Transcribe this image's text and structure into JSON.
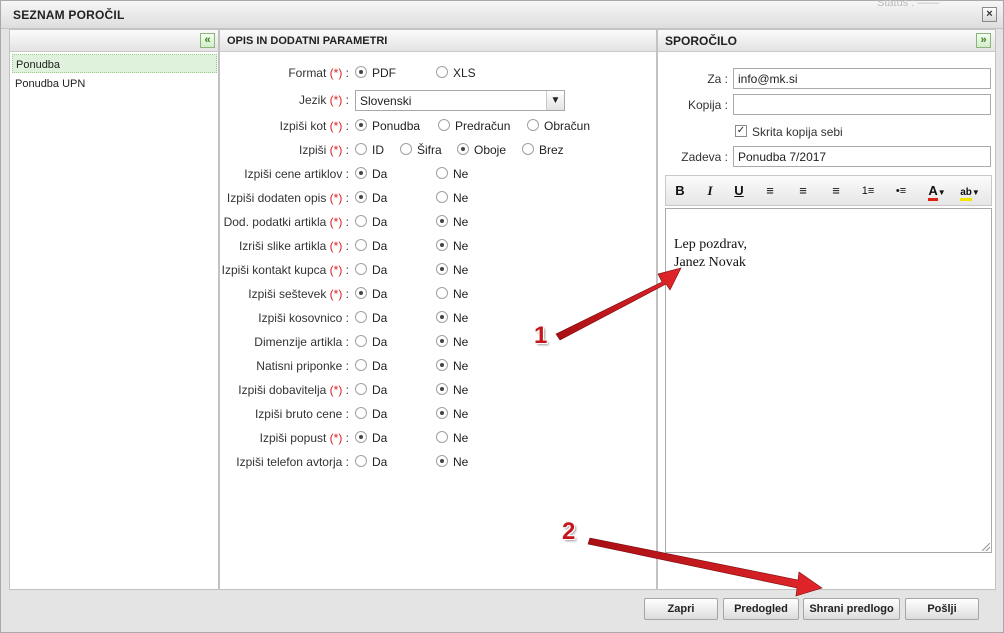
{
  "window": {
    "title": "SEZNAM POROČIL",
    "status": "Status : ——",
    "close_icon": "×"
  },
  "left_panel": {
    "collapse_icon": "«",
    "items": [
      {
        "label": "Ponudba",
        "selected": true
      },
      {
        "label": "Ponudba UPN",
        "selected": false
      }
    ]
  },
  "middle_panel": {
    "title": "OPIS IN DODATNI PARAMETRI",
    "rows": [
      {
        "label": "Format",
        "required": true,
        "type": "radio",
        "options": [
          {
            "label": "PDF",
            "checked": true
          },
          {
            "label": "XLS",
            "checked": false
          }
        ]
      },
      {
        "label": "Jezik",
        "required": true,
        "type": "select",
        "value": "Slovenski"
      },
      {
        "label": "Izpiši kot",
        "required": true,
        "type": "radio",
        "options": [
          {
            "label": "Ponudba",
            "checked": true
          },
          {
            "label": "Predračun",
            "checked": false
          },
          {
            "label": "Obračun",
            "checked": false
          }
        ]
      },
      {
        "label": "Izpiši",
        "required": true,
        "type": "radio",
        "options": [
          {
            "label": "ID",
            "checked": false
          },
          {
            "label": "Šifra",
            "checked": false
          },
          {
            "label": "Oboje",
            "checked": true
          },
          {
            "label": "Brez",
            "checked": false
          }
        ]
      },
      {
        "label": "Izpiši cene artiklov",
        "required": false,
        "type": "radio",
        "options": [
          {
            "label": "Da",
            "checked": true
          },
          {
            "label": "Ne",
            "checked": false
          }
        ]
      },
      {
        "label": "Izpiši dodaten opis",
        "required": true,
        "type": "radio",
        "options": [
          {
            "label": "Da",
            "checked": true
          },
          {
            "label": "Ne",
            "checked": false
          }
        ]
      },
      {
        "label": "Dod. podatki artikla",
        "required": true,
        "type": "radio",
        "options": [
          {
            "label": "Da",
            "checked": false
          },
          {
            "label": "Ne",
            "checked": true
          }
        ]
      },
      {
        "label": "Izriši slike artikla",
        "required": true,
        "type": "radio",
        "options": [
          {
            "label": "Da",
            "checked": false
          },
          {
            "label": "Ne",
            "checked": true
          }
        ]
      },
      {
        "label": "Izpiši kontakt kupca",
        "required": true,
        "type": "radio",
        "options": [
          {
            "label": "Da",
            "checked": false
          },
          {
            "label": "Ne",
            "checked": true
          }
        ]
      },
      {
        "label": "Izpiši seštevek",
        "required": true,
        "type": "radio",
        "options": [
          {
            "label": "Da",
            "checked": true
          },
          {
            "label": "Ne",
            "checked": false
          }
        ]
      },
      {
        "label": "Izpiši kosovnico",
        "required": false,
        "type": "radio",
        "options": [
          {
            "label": "Da",
            "checked": false
          },
          {
            "label": "Ne",
            "checked": true
          }
        ]
      },
      {
        "label": "Dimenzije artikla",
        "required": false,
        "type": "radio",
        "options": [
          {
            "label": "Da",
            "checked": false
          },
          {
            "label": "Ne",
            "checked": true
          }
        ]
      },
      {
        "label": "Natisni priponke",
        "required": false,
        "type": "radio",
        "options": [
          {
            "label": "Da",
            "checked": false
          },
          {
            "label": "Ne",
            "checked": true
          }
        ]
      },
      {
        "label": "Izpiši dobavitelja",
        "required": true,
        "type": "radio",
        "options": [
          {
            "label": "Da",
            "checked": false
          },
          {
            "label": "Ne",
            "checked": true
          }
        ]
      },
      {
        "label": "Izpiši bruto cene",
        "required": false,
        "type": "radio",
        "options": [
          {
            "label": "Da",
            "checked": false
          },
          {
            "label": "Ne",
            "checked": true
          }
        ]
      },
      {
        "label": "Izpiši popust",
        "required": true,
        "type": "radio",
        "options": [
          {
            "label": "Da",
            "checked": true
          },
          {
            "label": "Ne",
            "checked": false
          }
        ]
      },
      {
        "label": "Izpiši telefon avtorja",
        "required": false,
        "type": "radio",
        "options": [
          {
            "label": "Da",
            "checked": false
          },
          {
            "label": "Ne",
            "checked": true
          }
        ]
      }
    ]
  },
  "right_panel": {
    "title": "SPOROČILO",
    "expand_icon": "»",
    "to_label": "Za :",
    "to_value": "info@mk.si",
    "cc_label": "Kopija :",
    "cc_value": "",
    "bcc_self_label": "Skrita kopija sebi",
    "bcc_self_checked": true,
    "subject_label": "Zadeva :",
    "subject_value": "Ponudba 7/2017",
    "toolbar": {
      "bold": "B",
      "italic": "I",
      "underline": "U",
      "align_left": "≡",
      "align_center": "≡",
      "align_right": "≡",
      "ordered_list": "1≡",
      "bullet_list": "•≡",
      "font_color": "A",
      "highlight": "ab"
    },
    "body_lines": [
      "Lep pozdrav,",
      "Janez Novak"
    ]
  },
  "buttons": {
    "close": "Zapri",
    "preview": "Predogled",
    "save_template": "Shrani predlogo",
    "send": "Pošlji"
  },
  "annotations": {
    "one": "1",
    "two": "2"
  },
  "colors": {
    "annotation": "#c5161b",
    "selected_row": "#dff3dc",
    "required": "#dd2222"
  }
}
